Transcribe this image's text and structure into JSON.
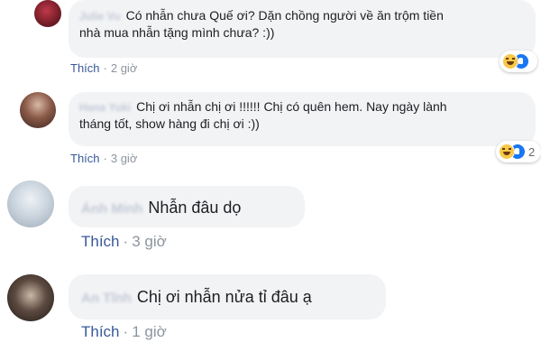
{
  "colors": {
    "bubble": "#f2f3f5",
    "link": "#385898",
    "meta": "#8d949e",
    "haha": "#f7c948",
    "like": "#1877f2"
  },
  "comments": [
    {
      "author": "Julie Vu",
      "text_line1": "Có nhẫn chưa Quế ơi? Dặn chồng người về ăn trộm tiền",
      "text_line2": "nhà mua nhẫn tặng mình chưa? :))",
      "like_label": "Thích",
      "separator": "·",
      "time": "2 giờ",
      "reactions": [
        "haha-icon",
        "like-icon"
      ]
    },
    {
      "author": "Hana Yuki",
      "text_line1": "Chị ơi nhẫn chị ơi !!!!!! Chị có quên hem. Nay ngày lành",
      "text_line2": "tháng tốt, show hàng đi chị ơi :))",
      "like_label": "Thích",
      "separator": "·",
      "time": "3 giờ",
      "reactions": [
        "haha-icon",
        "like-icon"
      ],
      "reaction_count": "2"
    },
    {
      "author": "Ánh Minh",
      "text": "Nhẫn đâu dọ",
      "like_label": "Thích",
      "separator": "·",
      "time": "3 giờ"
    },
    {
      "author": "An Tĩnh",
      "text": "Chị ơi nhẫn nửa tỉ đâu ạ",
      "like_label": "Thích",
      "separator": "·",
      "time": "1 giờ"
    }
  ]
}
